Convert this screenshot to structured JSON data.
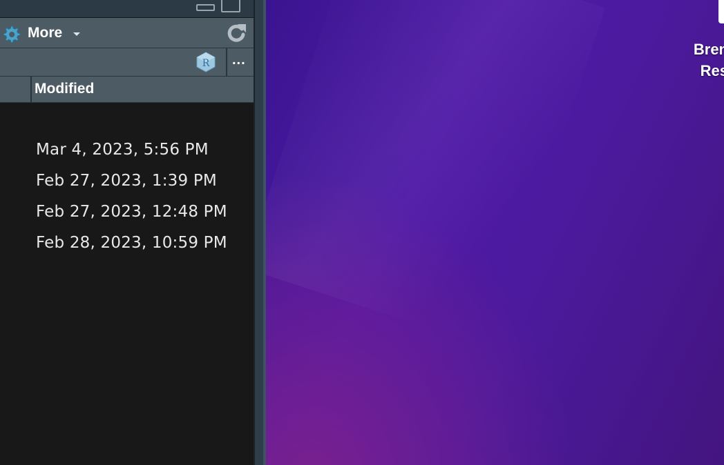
{
  "toolbar": {
    "more_label": "More",
    "gear_icon": "gear-icon",
    "refresh_icon": "refresh-icon"
  },
  "pathbar": {
    "project_icon": "r-project-icon",
    "ellipsis": "..."
  },
  "file_table": {
    "columns": [
      "Modified"
    ],
    "rows": [
      {
        "modified": "Mar 4, 2023, 5:56 PM"
      },
      {
        "modified": "Feb 27, 2023, 1:39 PM"
      },
      {
        "modified": "Feb 27, 2023, 12:48 PM"
      },
      {
        "modified": "Feb 28, 2023, 10:59 PM"
      }
    ]
  },
  "desktop": {
    "icon_label_line1": "Bren",
    "icon_label_line2": "Res"
  },
  "colors": {
    "toolbar_bg": "#4d5b65",
    "pane_bg": "#181818",
    "desktop_purple": "#4f1aa6"
  }
}
